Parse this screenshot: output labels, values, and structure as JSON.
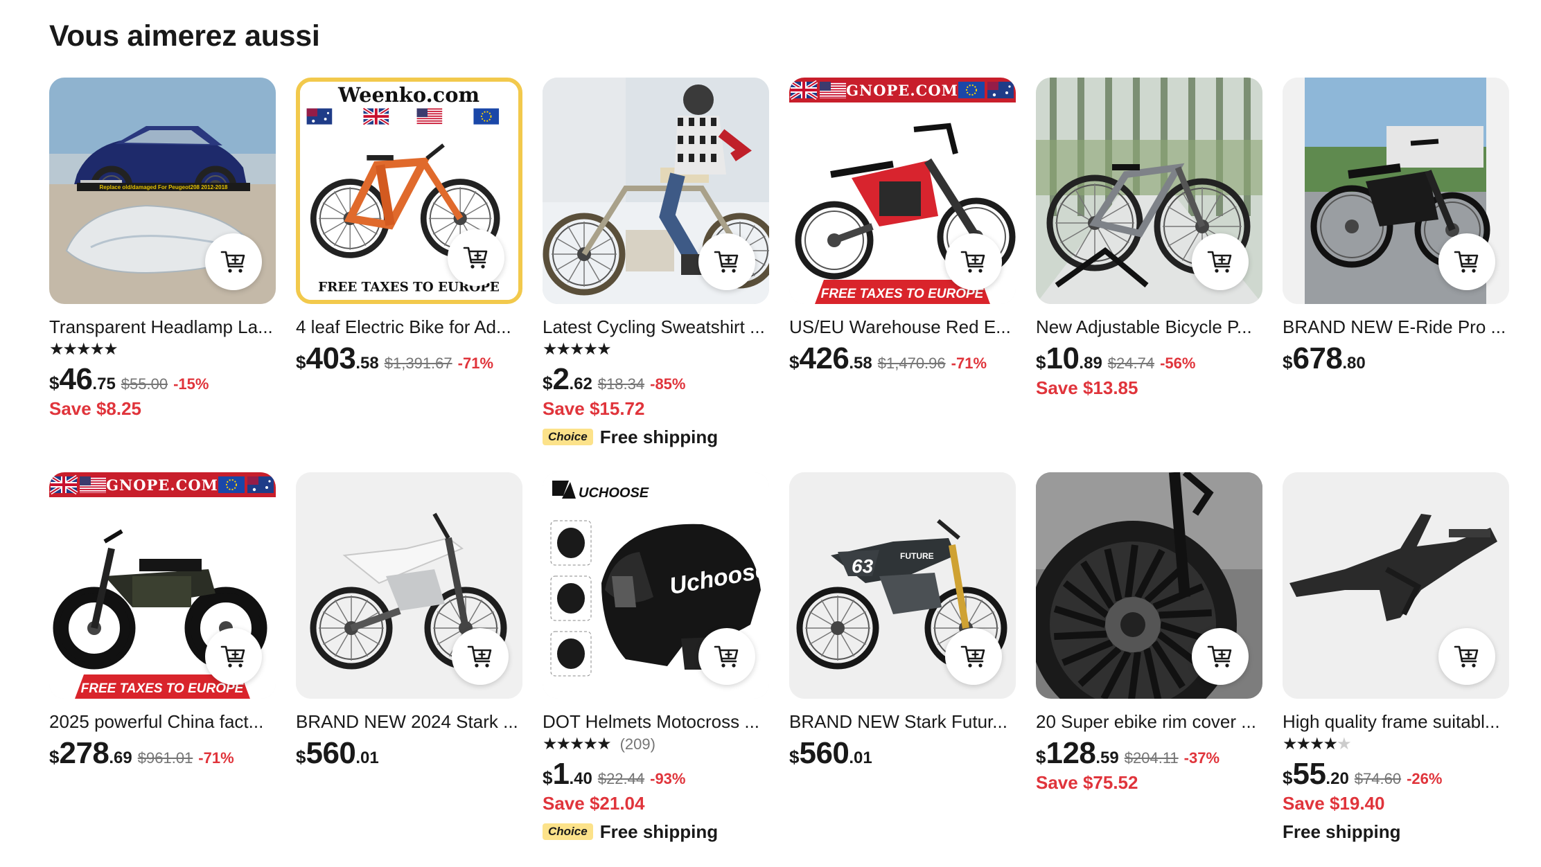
{
  "section_title": "Vous aimerez aussi",
  "add_to_cart_icon": "cart-plus-icon",
  "products": [
    {
      "title": "Transparent Headlamp La...",
      "rating": 5,
      "rating_count": "",
      "currency": "$",
      "price_int": "46",
      "price_dec": ".75",
      "original_price": "$55.00",
      "discount": "-15%",
      "save": "Save $8.25",
      "choice": false,
      "shipping": "",
      "image": "headlamp",
      "overlay": "Replace old/damaged For Peugeot208 2012-2018"
    },
    {
      "title": "4 leaf Electric Bike for Ad...",
      "rating": 0,
      "rating_count": "",
      "currency": "$",
      "price_int": "403",
      "price_dec": ".58",
      "original_price": "$1,391.67",
      "discount": "-71%",
      "save": "",
      "choice": false,
      "shipping": "",
      "image": "weenko-bike",
      "overlay_top": "Weenko.com",
      "overlay_bottom": "FREE TAXES TO EUROPE"
    },
    {
      "title": "Latest Cycling Sweatshirt ...",
      "rating": 4.5,
      "rating_count": "",
      "currency": "$",
      "price_int": "2",
      "price_dec": ".62",
      "original_price": "$18.34",
      "discount": "-85%",
      "save": "Save $15.72",
      "choice": true,
      "choice_label": "Choice",
      "shipping": "Free shipping",
      "image": "snow-rider"
    },
    {
      "title": "US/EU Warehouse Red E...",
      "rating": 0,
      "rating_count": "",
      "currency": "$",
      "price_int": "426",
      "price_dec": ".58",
      "original_price": "$1,470.96",
      "discount": "-71%",
      "save": "",
      "choice": false,
      "shipping": "",
      "image": "red-ebike",
      "overlay_top": "GNOPE.COM",
      "overlay_bottom": "FREE TAXES TO EUROPE"
    },
    {
      "title": "New Adjustable Bicycle P...",
      "rating": 0,
      "rating_count": "",
      "currency": "$",
      "price_int": "10",
      "price_dec": ".89",
      "original_price": "$24.74",
      "discount": "-56%",
      "save": "Save $13.85",
      "choice": false,
      "shipping": "",
      "image": "bike-stand"
    },
    {
      "title": "BRAND NEW E-Ride Pro ...",
      "rating": 0,
      "rating_count": "",
      "currency": "$",
      "price_int": "678",
      "price_dec": ".80",
      "original_price": "",
      "discount": "",
      "save": "",
      "choice": false,
      "shipping": "",
      "image": "eride-pro"
    },
    {
      "title": "2025 powerful China fact...",
      "rating": 0,
      "rating_count": "",
      "currency": "$",
      "price_int": "278",
      "price_dec": ".69",
      "original_price": "$961.01",
      "discount": "-71%",
      "save": "",
      "choice": false,
      "shipping": "",
      "image": "fatbike",
      "overlay_top": "GNOPE.COM",
      "overlay_bottom": "FREE TAXES TO EUROPE"
    },
    {
      "title": "BRAND NEW 2024 Stark ...",
      "rating": 0,
      "rating_count": "",
      "currency": "$",
      "price_int": "560",
      "price_dec": ".01",
      "original_price": "",
      "discount": "",
      "save": "",
      "choice": false,
      "shipping": "",
      "image": "white-dirtbike"
    },
    {
      "title": "DOT Helmets Motocross ...",
      "rating": 4.5,
      "rating_count": "(209)",
      "currency": "$",
      "price_int": "1",
      "price_dec": ".40",
      "original_price": "$22.44",
      "discount": "-93%",
      "save": "Save $21.04",
      "choice": true,
      "choice_label": "Choice",
      "shipping": "Free shipping",
      "image": "helmet",
      "overlay_top": "UCHOOSE",
      "overlay_helmet": "Uchoose"
    },
    {
      "title": "BRAND NEW Stark Futur...",
      "rating": 0,
      "rating_count": "",
      "currency": "$",
      "price_int": "560",
      "price_dec": ".01",
      "original_price": "",
      "discount": "",
      "save": "",
      "choice": false,
      "shipping": "",
      "image": "stark-future",
      "overlay": "63",
      "overlay_frame": "FUTURE"
    },
    {
      "title": "20 Super ebike rim cover ...",
      "rating": 0,
      "rating_count": "",
      "currency": "$",
      "price_int": "128",
      "price_dec": ".59",
      "original_price": "$204.11",
      "discount": "-37%",
      "save": "Save $75.52",
      "choice": false,
      "shipping": "",
      "image": "rim-cover"
    },
    {
      "title": "High quality frame suitabl...",
      "rating": 4,
      "rating_count": "",
      "currency": "$",
      "price_int": "55",
      "price_dec": ".20",
      "original_price": "$74.60",
      "discount": "-26%",
      "save": "Save $19.40",
      "choice": false,
      "shipping": "Free shipping",
      "image": "frame"
    }
  ],
  "colors": {
    "discount_red": "#e0343b",
    "choice_yellow": "#fce28a",
    "banner_red": "#d9242b"
  }
}
